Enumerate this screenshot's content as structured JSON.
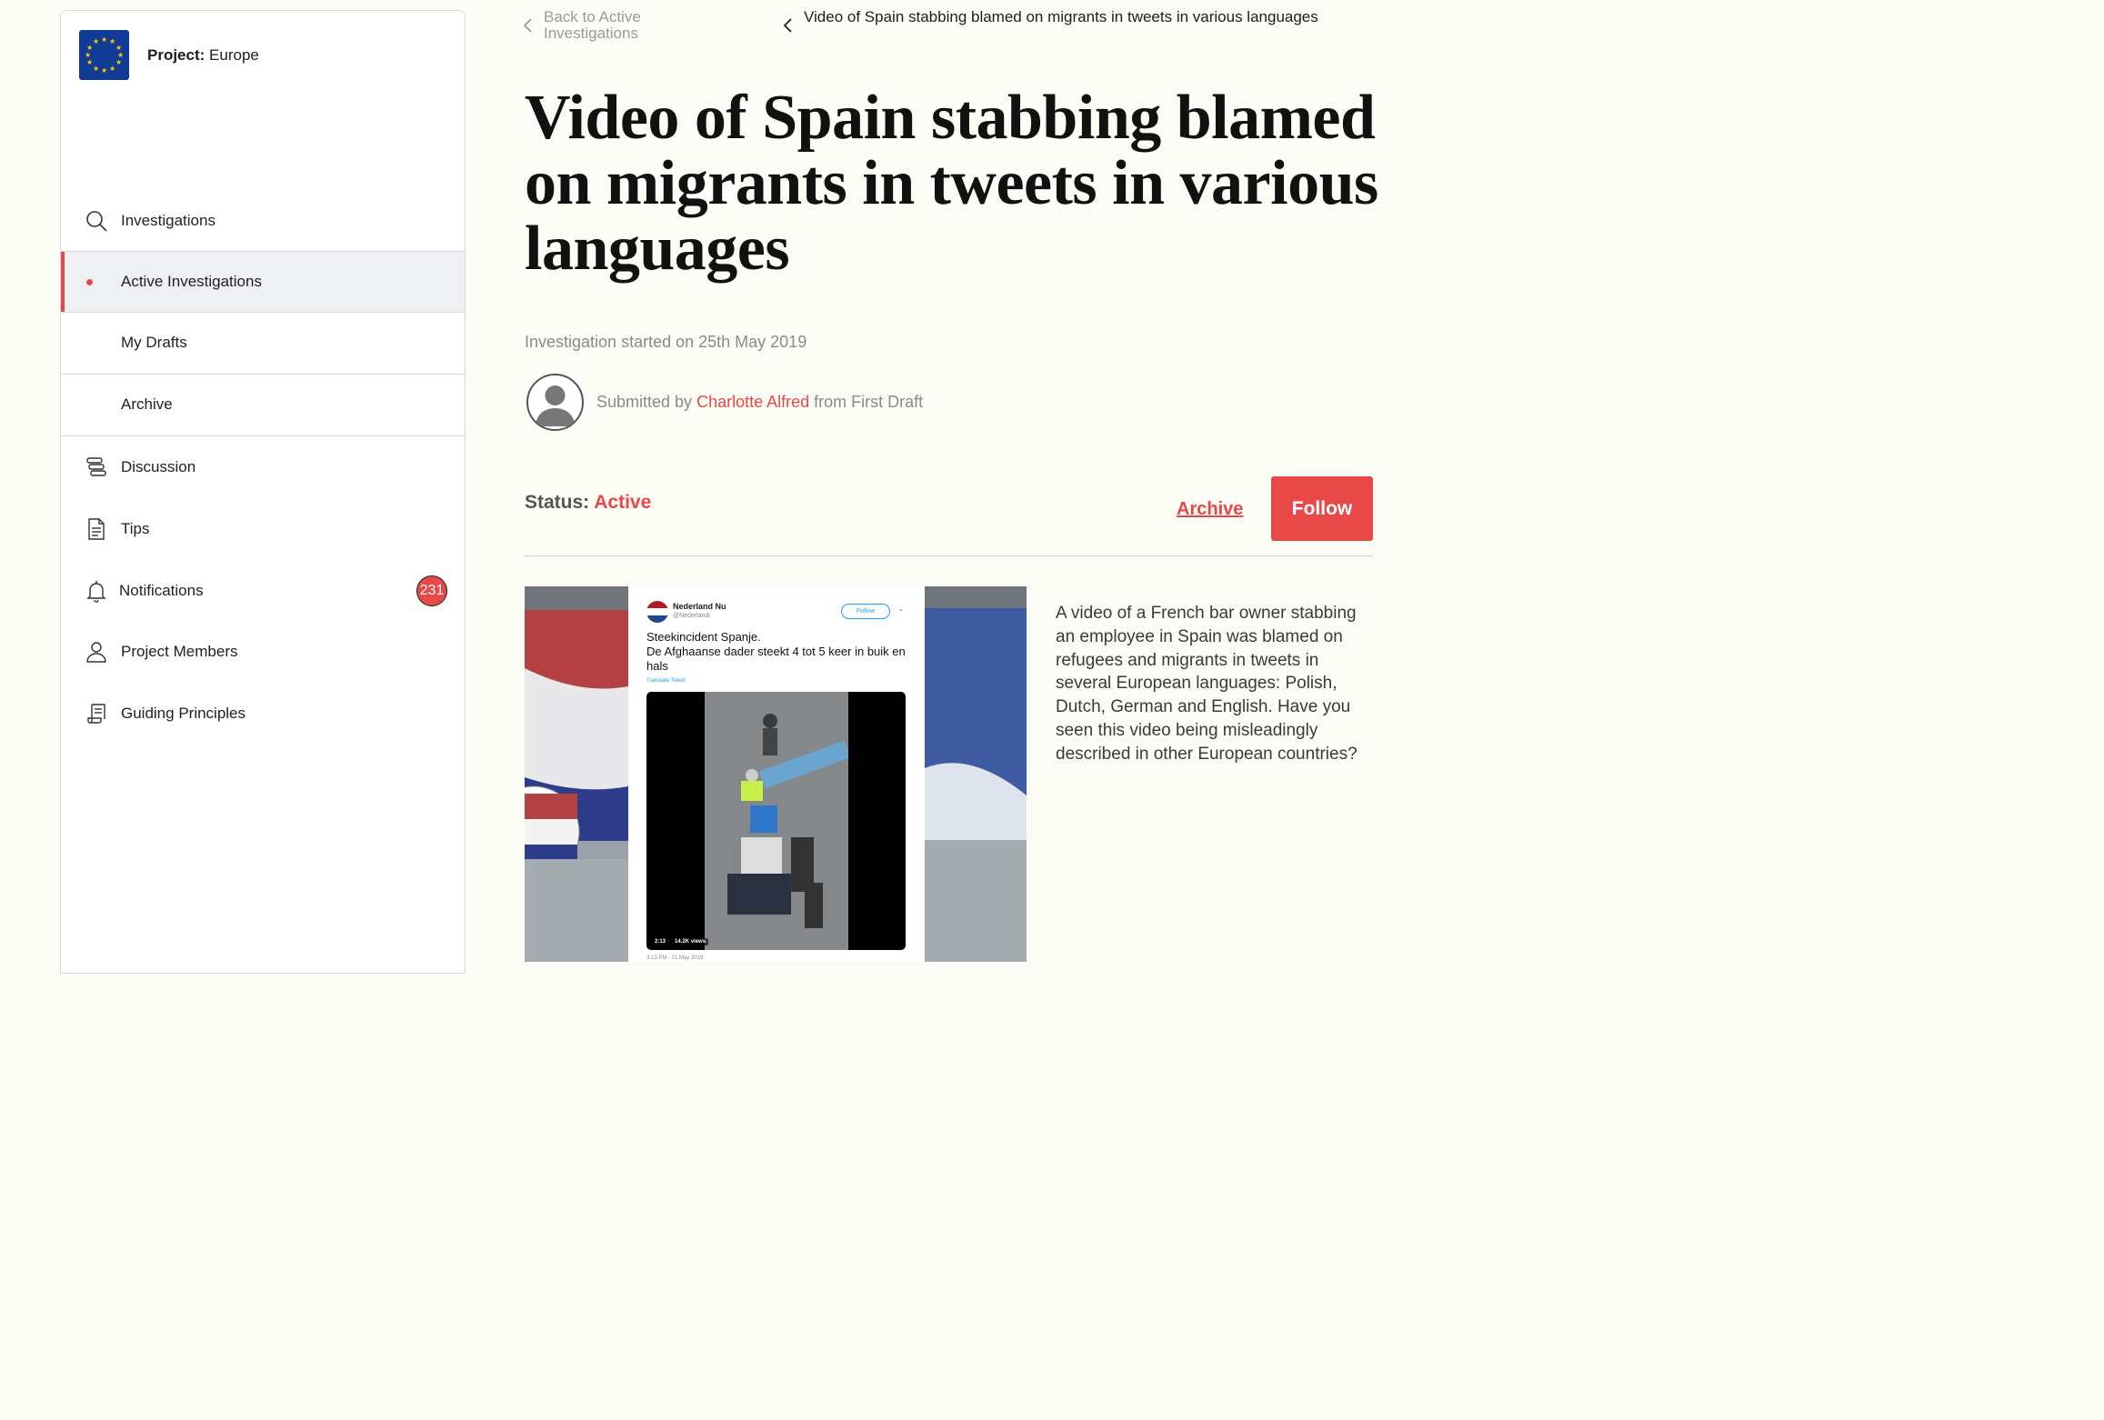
{
  "project": {
    "prefix": "Project:",
    "name": "Europe"
  },
  "sidebar": {
    "items": [
      {
        "label": "Investigations",
        "icon": "search-icon"
      },
      {
        "label": "Active Investigations",
        "icon": "dot-indicator"
      },
      {
        "label": "My Drafts"
      },
      {
        "label": "Archive"
      },
      {
        "label": "Discussion",
        "icon": "discussion-icon"
      },
      {
        "label": "Tips",
        "icon": "document-icon"
      },
      {
        "label": "Notifications",
        "icon": "bell-icon",
        "badge": "231"
      },
      {
        "label": "Project Members",
        "icon": "user-icon"
      },
      {
        "label": "Guiding Principles",
        "icon": "scroll-icon"
      }
    ]
  },
  "breadcrumbs": {
    "back_label": "Back to Active Investigations",
    "current_label": "Video of Spain stabbing blamed on migrants in tweets in various languages"
  },
  "article": {
    "title": "Video of Spain stabbing blamed on migrants in tweets in various languages",
    "started": "Investigation started on 25th May 2019",
    "submitted_prefix": "Submitted by",
    "submitter_name": "Charlotte Alfred",
    "submitted_suffix": "from First Draft",
    "status_label": "Status:",
    "status_value": "Active",
    "archive_label": "Archive",
    "follow_label": "Follow",
    "description": "A video of a French bar owner stabbing an employee in Spain was blamed on refugees and migrants in tweets in several European languages: Polish, Dutch, German and English. Have you seen this video being misleadingly described in other European countries?"
  },
  "tweet": {
    "account_name": "Nederland Nu",
    "handle": "@Nederlandi",
    "follow_label": "Follow",
    "text_line1": "Steekincident Spanje.",
    "text_line2": "De Afghaanse dader steekt 4 tot 5 keer in buik en hals",
    "translate": "Translate Tweet",
    "duration": "2:13",
    "views": "14.2K views",
    "date": "3:13 PM - 21 May 2019"
  },
  "colors": {
    "accent": "#e84848",
    "background": "#fcfcf7",
    "flag_blue": "#0f3b96"
  }
}
